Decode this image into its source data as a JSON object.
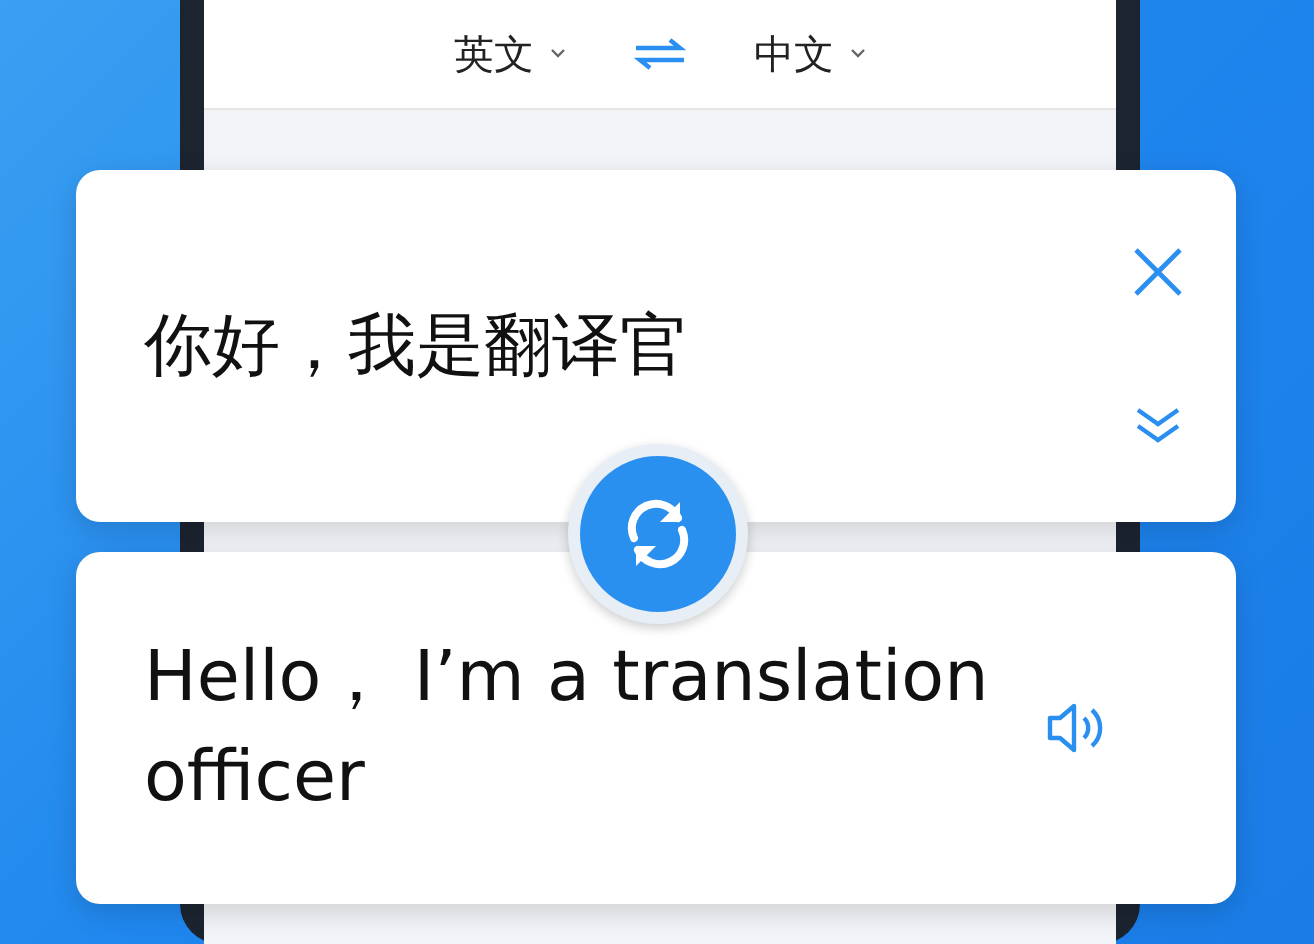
{
  "language_bar": {
    "source": "英文",
    "target": "中文"
  },
  "source_card": {
    "text": "你好，我是翻译官"
  },
  "result_card": {
    "text": "Hello， I’m a translation officer"
  }
}
